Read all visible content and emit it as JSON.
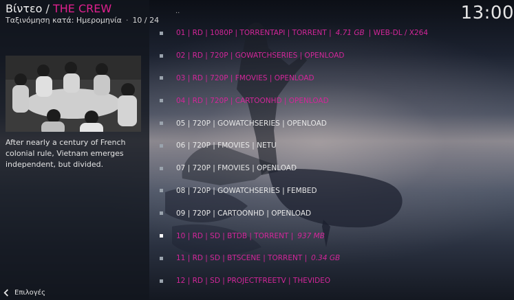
{
  "header": {
    "section": "Βίντεο",
    "separator": "/",
    "show_title": "THE CREW",
    "sort_label": "Ταξινόμηση κατά: Ημερομηνία",
    "position": "10 / 24",
    "clock": "13:00"
  },
  "sidebar": {
    "plot": "After nearly a century of French colonial rule, Vietnam emerges independent, but divided.",
    "options_label": "Επιλογές"
  },
  "list": {
    "parent": "..",
    "items": [
      {
        "label": "01 | RD | 1080P | TORRENTAPI | TORRENT |",
        "size": "4.71 GB",
        "extra": "| WEB-DL / X264",
        "style": "accent"
      },
      {
        "label": "02 | RD | 720P | GOWATCHSERIES | OPENLOAD",
        "style": "accent"
      },
      {
        "label": "03 | RD | 720P | FMOVIES | OPENLOAD",
        "style": "accent"
      },
      {
        "label": "04 | RD | 720P | CARTOONHD | OPENLOAD",
        "style": "accent"
      },
      {
        "label": "05 | 720P | GOWATCHSERIES | OPENLOAD",
        "style": "plain"
      },
      {
        "label": "06 | 720P | FMOVIES | NETU",
        "style": "plain"
      },
      {
        "label": "07 | 720P | FMOVIES | OPENLOAD",
        "style": "plain"
      },
      {
        "label": "08 | 720P | GOWATCHSERIES | FEMBED",
        "style": "plain"
      },
      {
        "label": "09 | 720P | CARTOONHD | OPENLOAD",
        "style": "plain"
      },
      {
        "label": "10 | RD | SD | BTDB | TORRENT |",
        "size": "937 MB",
        "style": "accent",
        "selected": true
      },
      {
        "label": "11 | RD | SD | BTSCENE | TORRENT |",
        "size": "0.34 GB",
        "style": "accent"
      },
      {
        "label": "12 | RD | SD | PROJECTFREETV | THEVIDEO",
        "style": "accent"
      }
    ]
  },
  "colors": {
    "accent": "#e0208e",
    "link_accent": "#d3269a",
    "text": "#e8e8e8"
  }
}
